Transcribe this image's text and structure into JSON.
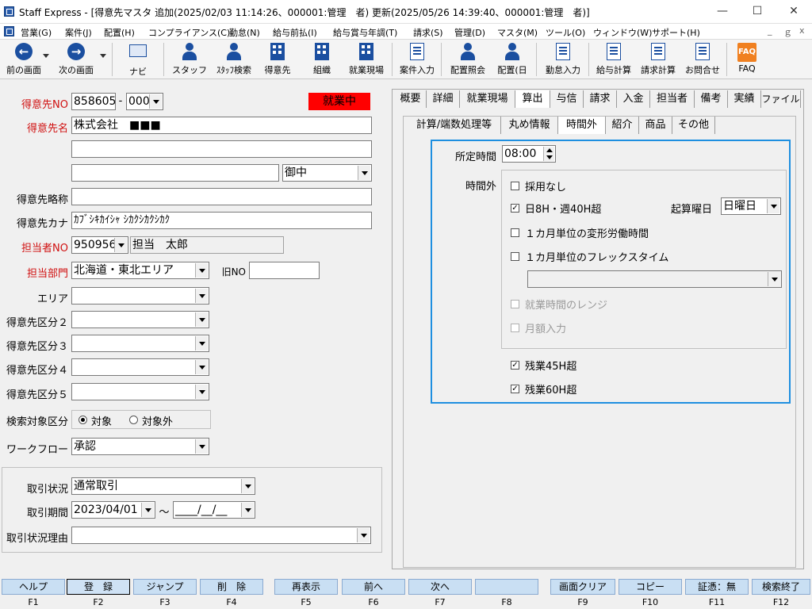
{
  "window": {
    "title": "Staff Express - [得意先マスタ 追加(2025/02/03 11:14:26、000001:管理　者) 更新(2025/05/26 14:39:40、000001:管理　者)]",
    "minimize": "—",
    "maximize": "☐",
    "close": "✕"
  },
  "menu": [
    "営業(G)",
    "案件(J)",
    "配置(H)",
    "コンプライアンス(C)",
    "勤怠(N)",
    "給与前払(I)",
    "給与賞与年調(T)",
    "請求(S)",
    "管理(D)",
    "マスタ(M)",
    "ツール(O)",
    "ウィンドウ(W)",
    "サポート(H)"
  ],
  "menu_controls": [
    "_",
    "ｇ",
    "x"
  ],
  "toolbar": {
    "prev": "前の画面",
    "next": "次の画面",
    "navi": "ナビ",
    "staff": "スタッフ",
    "staff_search": "ｽﾀｯﾌ検索",
    "customer": "得意先",
    "org": "組織",
    "worksite": "就業現場",
    "job_entry": "案件入力",
    "assign_inquiry": "配置照会",
    "assign_day": "配置(日",
    "attendance": "勤怠入力",
    "payroll": "給与計算",
    "billing": "請求計算",
    "contact": "お問合せ",
    "faq": "FAQ",
    "faq_icon_text": "FAQ"
  },
  "form": {
    "customer_no_label": "得意先NO",
    "customer_no": "858605",
    "customer_no_dash": "-",
    "customer_branch": "000",
    "status_badge": "就業中",
    "customer_name_label": "得意先名",
    "customer_name": "株式会社　■■■",
    "customer_name2": "",
    "customer_name3": "",
    "honorific": "御中",
    "abbr_label": "得意先略称",
    "abbr": "",
    "kana_label": "得意先カナ",
    "kana": "ｶﾌﾞｼｷｶｲｼｬ ｼｶｸｼｶｸｼｶｸ",
    "rep_no_label": "担当者NO",
    "rep_no": "950956",
    "rep_name": "担当　太郎",
    "dept_label": "担当部門",
    "dept": "北海道・東北エリア",
    "old_no_label": "旧NO",
    "old_no": "",
    "area_label": "エリア",
    "cat2_label": "得意先区分２",
    "cat3_label": "得意先区分３",
    "cat4_label": "得意先区分４",
    "cat5_label": "得意先区分５",
    "search_target_label": "検索対象区分",
    "search_target_on": "対象",
    "search_target_off": "対象外",
    "workflow_label": "ワークフロー",
    "workflow": "承認",
    "trade_status_label": "取引状況",
    "trade_status": "通常取引",
    "trade_period_label": "取引期間",
    "trade_from": "2023/04/01",
    "tilde": "～",
    "trade_to": "____/__/__",
    "trade_reason_label": "取引状況理由"
  },
  "tabs_top": [
    "概要",
    "詳細",
    "就業現場",
    "算出",
    "与信",
    "請求",
    "入金",
    "担当者",
    "備考",
    "実績",
    "ファイル"
  ],
  "tabs_sub": [
    "計算/端数処理等",
    "丸め情報",
    "時間外",
    "紹介",
    "商品",
    "その他"
  ],
  "overtime": {
    "regular_hours_label": "所定時間",
    "regular_hours": "08:00",
    "overtime_label": "時間外",
    "opt_none": "採用なし",
    "opt_8h40h": "日8H・週40H超",
    "start_day_label": "起算曜日",
    "start_day": "日曜日",
    "opt_monthly_variable": "１カ月単位の変形労働時間",
    "opt_monthly_flex": "１カ月単位のフレックスタイム",
    "opt_work_range": "就業時間のレンジ",
    "opt_monthly_amount": "月額入力",
    "ot45": "残業45H超",
    "ot60": "残業60H超",
    "check_mark": "✓"
  },
  "fkeys": [
    {
      "label": "ヘルプ",
      "key": "F1"
    },
    {
      "label": "登　録",
      "key": "F2"
    },
    {
      "label": "ジャンプ",
      "key": "F3"
    },
    {
      "label": "削　除",
      "key": "F4"
    },
    {
      "label": "再表示",
      "key": "F5"
    },
    {
      "label": "前へ",
      "key": "F6"
    },
    {
      "label": "次へ",
      "key": "F7"
    },
    {
      "label": "",
      "key": "F8"
    },
    {
      "label": "画面クリア",
      "key": "F9"
    },
    {
      "label": "コピー",
      "key": "F10"
    },
    {
      "label": "証憑：無",
      "key": "F11"
    },
    {
      "label": "検索終了",
      "key": "F12"
    }
  ],
  "colors": {
    "status_red": "#ff0000",
    "label_red": "#d01010",
    "panel_border": "#1e8fe0",
    "fkey_bg": "#c9dff3"
  }
}
